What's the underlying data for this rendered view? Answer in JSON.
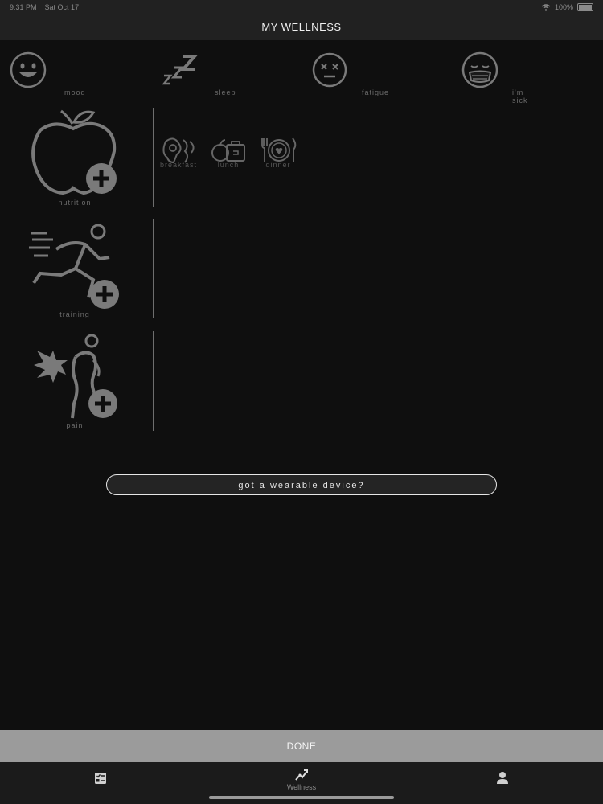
{
  "status_bar": {
    "time": "9:31 PM",
    "date": "Sat Oct 17",
    "battery": "100%"
  },
  "nav": {
    "title": "MY WELLNESS"
  },
  "quick_actions": [
    {
      "label": "mood",
      "icon": "smile-face-icon"
    },
    {
      "label": "sleep",
      "icon": "zzz-sleep-icon"
    },
    {
      "label": "fatigue",
      "icon": "tired-face-icon"
    },
    {
      "label": "i'm sick",
      "icon": "mask-face-icon"
    }
  ],
  "categories": [
    {
      "label": "nutrition",
      "icon": "apple-plus-icon"
    },
    {
      "label": "training",
      "icon": "runner-plus-icon"
    },
    {
      "label": "pain",
      "icon": "pain-body-plus-icon"
    }
  ],
  "meals": [
    {
      "label": "breakfast",
      "icon": "breakfast-plate-icon"
    },
    {
      "label": "lunch",
      "icon": "lunchbox-apple-icon"
    },
    {
      "label": "dinner",
      "icon": "dinner-plate-icon"
    }
  ],
  "wearable_button": {
    "label": "got a wearable device?"
  },
  "done_button": {
    "label": "DONE"
  },
  "tabs": [
    {
      "label": "",
      "icon": "checklist-icon"
    },
    {
      "label": "Wellness",
      "icon": "wellness-chart-icon"
    },
    {
      "label": "",
      "icon": "profile-icon"
    }
  ],
  "colors": {
    "background": "#0f0f0f",
    "header": "#212121",
    "done_bar": "#9b9b9b",
    "icon_grey": "#7a7a7a"
  }
}
